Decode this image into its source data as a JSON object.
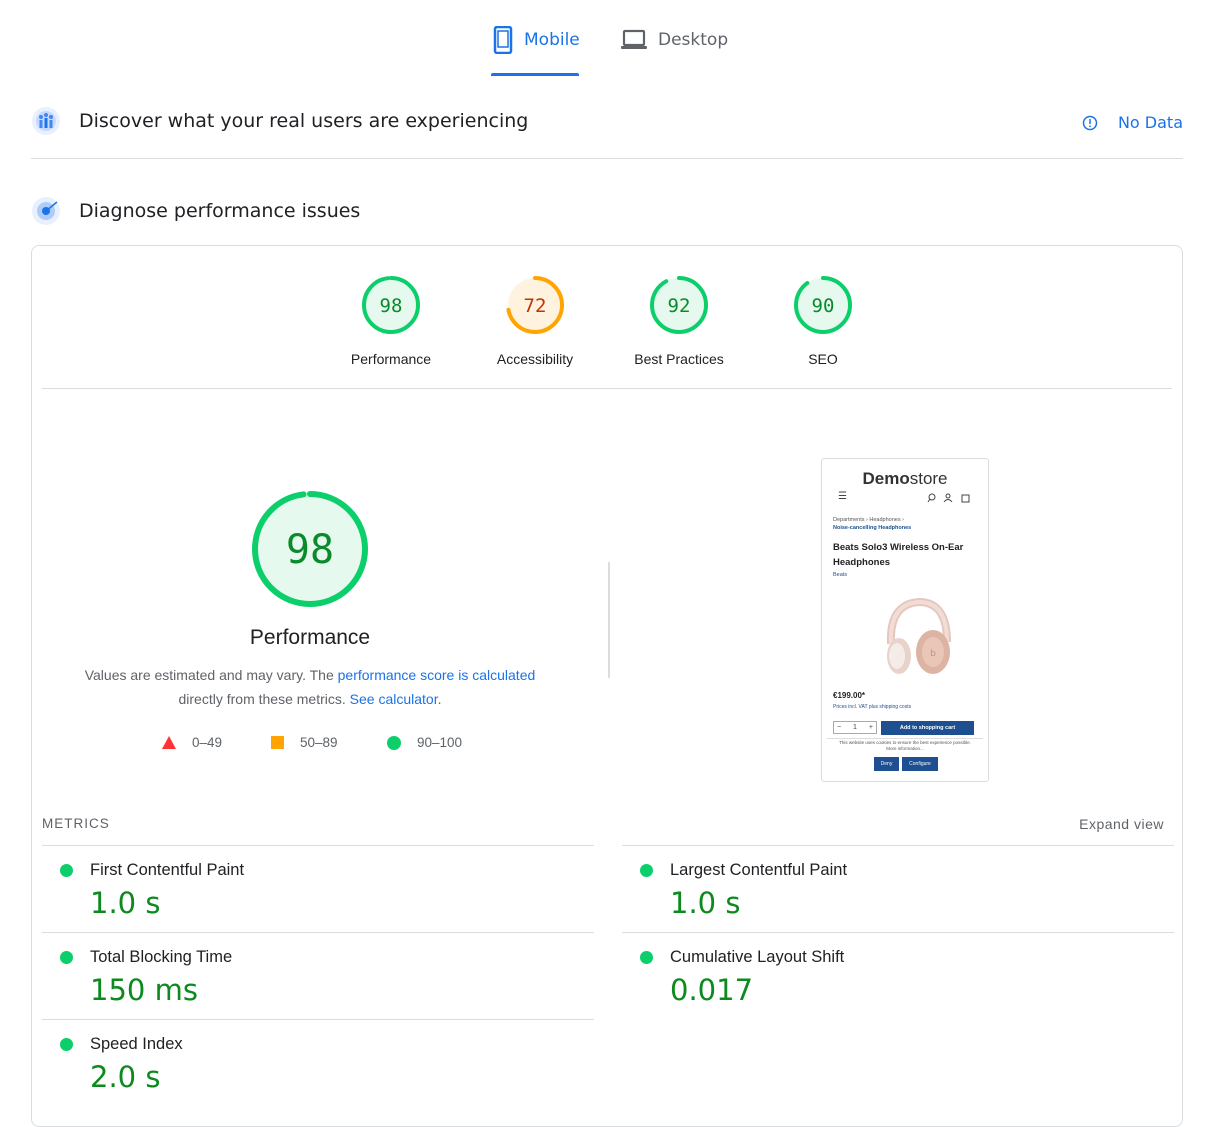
{
  "tabs": [
    {
      "label": "Mobile",
      "active": true
    },
    {
      "label": "Desktop",
      "active": false
    }
  ],
  "field_section": {
    "title": "Discover what your real users are experiencing",
    "status": "No Data"
  },
  "lab_section": {
    "title": "Diagnose performance issues"
  },
  "categories": [
    {
      "label": "Performance",
      "score": "98",
      "score_value": 98,
      "color": "#0cce6b",
      "text_color": "#0a8a2a"
    },
    {
      "label": "Accessibility",
      "score": "72",
      "score_value": 72,
      "color": "#ffa400",
      "text_color": "#c33300"
    },
    {
      "label": "Best Practices",
      "score": "92",
      "score_value": 92,
      "color": "#0cce6b",
      "text_color": "#0a8a2a"
    },
    {
      "label": "SEO",
      "score": "90",
      "score_value": 90,
      "color": "#0cce6b",
      "text_color": "#0a8a2a"
    }
  ],
  "performance": {
    "score": "98",
    "score_value": 98,
    "label": "Performance",
    "desc_1": "Values are estimated and may vary. The ",
    "desc_link1": "performance score is calculated",
    "desc_2": "directly from these metrics. ",
    "desc_link2": "See calculator",
    "desc_3": "."
  },
  "legend": [
    {
      "range": "0–49",
      "color": "#ff3333"
    },
    {
      "range": "50–89",
      "color": "#ffa400"
    },
    {
      "range": "90–100",
      "color": "#0cce6b"
    }
  ],
  "screenshot": {
    "brand_bold": "Demo",
    "brand_rest": "store",
    "breadcrumb_1": "Departments",
    "breadcrumb_2": "Headphones",
    "breadcrumb_3": "Noise-cancelling Headphones",
    "product_title": "Beats Solo3 Wireless On-Ear Headphones",
    "brand_link": "Beats",
    "price": "€199.00*",
    "price_note": "Prices incl. VAT plus shipping costs",
    "qty": "1",
    "add_to_cart": "Add to shopping cart",
    "cookie_text": "This website uses cookies to ensure the best experience possible. More information...",
    "deny": "Deny",
    "configure": "Configure"
  },
  "metrics": {
    "title": "METRICS",
    "expand": "Expand view",
    "items": [
      {
        "label": "First Contentful Paint",
        "value": "1.0 s"
      },
      {
        "label": "Largest Contentful Paint",
        "value": "1.0 s"
      },
      {
        "label": "Total Blocking Time",
        "value": "150 ms"
      },
      {
        "label": "Cumulative Layout Shift",
        "value": "0.017"
      },
      {
        "label": "Speed Index",
        "value": "2.0 s"
      }
    ]
  },
  "colors": {
    "accent": "#1a73e8",
    "good": "#0cce6b",
    "good_text": "#0c8a1e",
    "average": "#ffa400",
    "poor": "#ff3333"
  }
}
